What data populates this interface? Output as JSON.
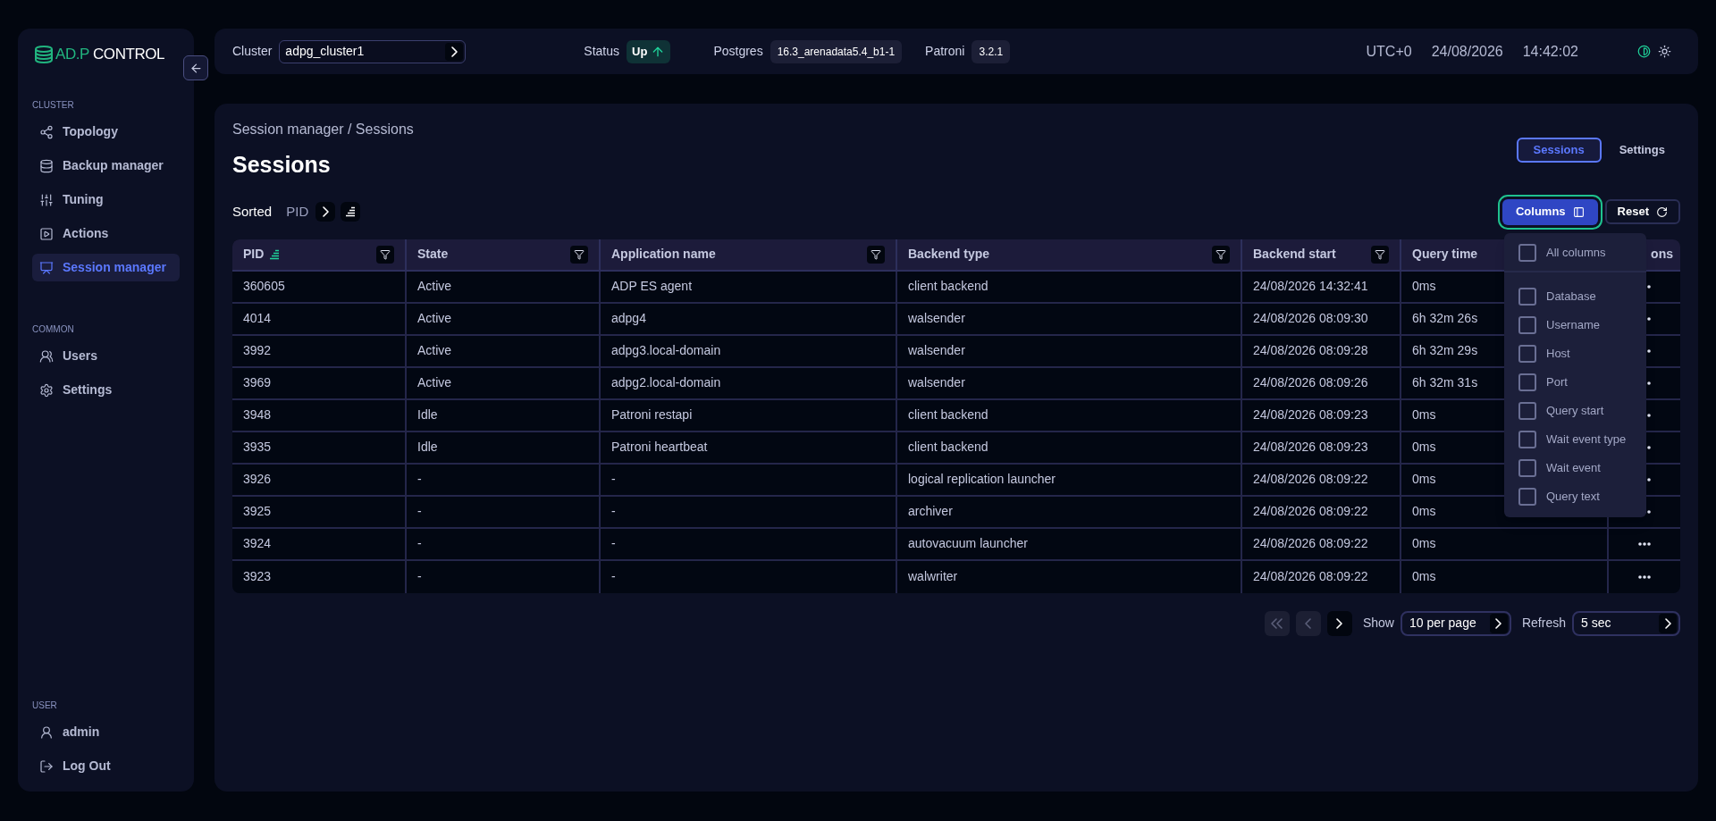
{
  "logo": {
    "accent": "AD.P",
    "name": "CONTROL"
  },
  "sidebar": {
    "sections": [
      {
        "title": "CLUSTER",
        "items": [
          {
            "label": "Topology",
            "selected": false
          },
          {
            "label": "Backup manager",
            "selected": false
          },
          {
            "label": "Tuning",
            "selected": false
          },
          {
            "label": "Actions",
            "selected": false
          },
          {
            "label": "Session manager",
            "selected": true
          }
        ]
      },
      {
        "title": "COMMON",
        "items": [
          {
            "label": "Users",
            "selected": false
          },
          {
            "label": "Settings",
            "selected": false
          }
        ]
      },
      {
        "title": "USER",
        "items": [
          {
            "label": "admin",
            "selected": false
          },
          {
            "label": "Log Out",
            "selected": false
          }
        ]
      }
    ]
  },
  "header": {
    "cluster": {
      "label": "Cluster",
      "value": "adpg_cluster1"
    },
    "status": {
      "label": "Status",
      "value": "Up"
    },
    "postgres": {
      "label": "Postgres",
      "value": "16.3_arenadata5.4_b1-1"
    },
    "patroni": {
      "label": "Patroni",
      "value": "3.2.1"
    },
    "timezone": "UTC+0",
    "date": "24/08/2026",
    "time": "14:42:02"
  },
  "page": {
    "breadcrumb": "Session manager / Sessions",
    "title": "Sessions",
    "tabs": [
      {
        "label": "Sessions",
        "selected": true
      },
      {
        "label": "Settings",
        "selected": false
      }
    ],
    "sort": {
      "label": "Sorted",
      "field": "PID"
    },
    "columns_button": {
      "label": "Columns",
      "expanded": true
    },
    "reset_button": {
      "label": "Reset"
    },
    "column_menu": {
      "all": {
        "label": "All columns",
        "checked": false
      },
      "items": [
        {
          "label": "Database",
          "checked": false
        },
        {
          "label": "Username",
          "checked": false
        },
        {
          "label": "Host",
          "checked": false
        },
        {
          "label": "Port",
          "checked": false
        },
        {
          "label": "Query start",
          "checked": false
        },
        {
          "label": "Wait event type",
          "checked": false
        },
        {
          "label": "Wait event",
          "checked": false
        },
        {
          "label": "Query text",
          "checked": false
        }
      ]
    }
  },
  "table": {
    "columns": [
      {
        "label": "PID",
        "sorted": true,
        "filter": true
      },
      {
        "label": "State",
        "sorted": false,
        "filter": true
      },
      {
        "label": "Application name",
        "sorted": false,
        "filter": true
      },
      {
        "label": "Backend type",
        "sorted": false,
        "filter": true
      },
      {
        "label": "Backend start",
        "sorted": false,
        "filter": true
      },
      {
        "label": "Query time",
        "sorted": false
      },
      {
        "label": "ons",
        "sorted": false
      }
    ],
    "rows": [
      [
        "360605",
        "Active",
        "ADP ES agent",
        "client backend",
        "24/08/2026 14:32:41",
        "0ms"
      ],
      [
        "4014",
        "Active",
        "adpg4",
        "walsender",
        "24/08/2026 08:09:30",
        "6h 32m 26s"
      ],
      [
        "3992",
        "Active",
        "adpg3.local-domain",
        "walsender",
        "24/08/2026 08:09:28",
        "6h 32m 29s"
      ],
      [
        "3969",
        "Active",
        "adpg2.local-domain",
        "walsender",
        "24/08/2026 08:09:26",
        "6h 32m 31s"
      ],
      [
        "3948",
        "Idle",
        "Patroni restapi",
        "client backend",
        "24/08/2026 08:09:23",
        "0ms"
      ],
      [
        "3935",
        "Idle",
        "Patroni heartbeat",
        "client backend",
        "24/08/2026 08:09:23",
        "0ms"
      ],
      [
        "3926",
        "-",
        "-",
        "logical replication launcher",
        "24/08/2026 08:09:22",
        "0ms"
      ],
      [
        "3925",
        "-",
        "-",
        "archiver",
        "24/08/2026 08:09:22",
        "0ms"
      ],
      [
        "3924",
        "-",
        "-",
        "autovacuum launcher",
        "24/08/2026 08:09:22",
        "0ms"
      ],
      [
        "3923",
        "-",
        "-",
        "walwriter",
        "24/08/2026 08:09:22",
        "0ms"
      ]
    ]
  },
  "pagination": {
    "first": {
      "disabled": true
    },
    "prev": {
      "disabled": true
    },
    "next": {
      "disabled": false
    },
    "show": {
      "label": "Show",
      "value": "10 per page"
    },
    "refresh": {
      "label": "Refresh",
      "value": "5 sec"
    }
  }
}
